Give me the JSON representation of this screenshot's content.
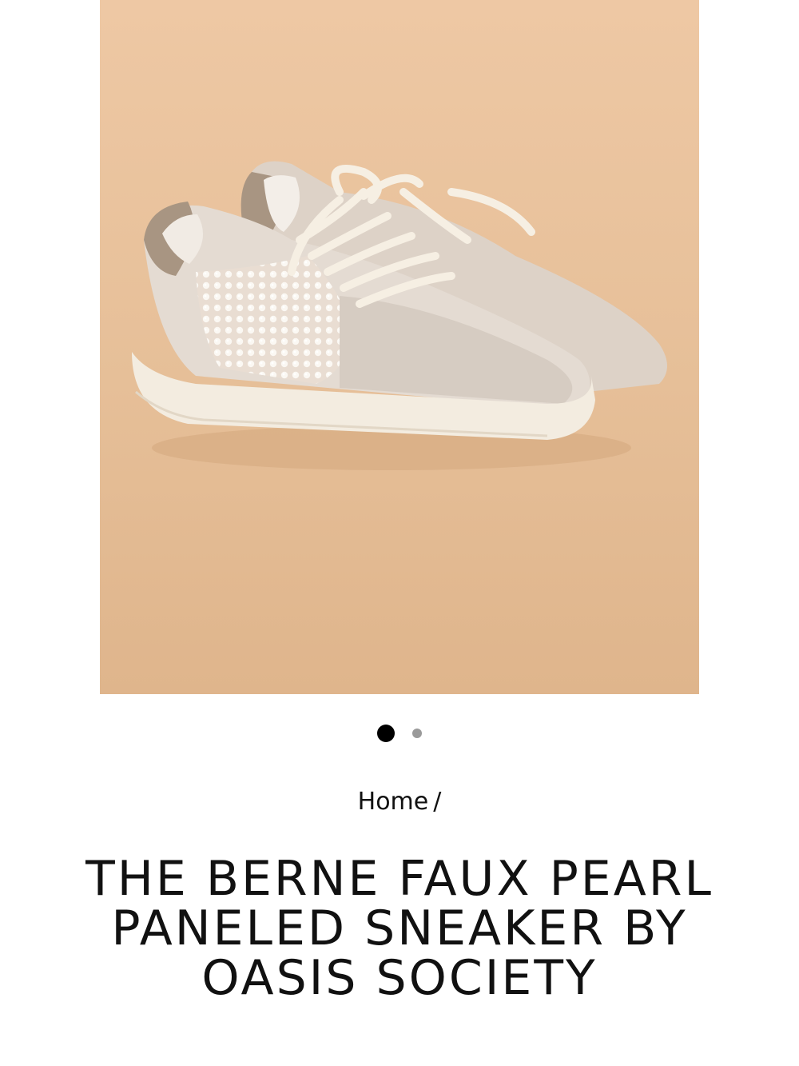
{
  "product_image": {
    "alt": "Faux pearl paneled sneakers on a peach background",
    "zoom_icon": "magnifier-icon",
    "colors": {
      "background": "#e8c29d",
      "shoe": "#e4dbd2",
      "sole": "#f3ece0",
      "heel_tab": "#a89582"
    }
  },
  "carousel": {
    "slides": 2,
    "active_index": 0
  },
  "breadcrumb": {
    "home": "Home",
    "separator": "/"
  },
  "product": {
    "title": "THE BERNE FAUX PEARL PANELED SNEAKER BY OASIS SOCIETY"
  }
}
